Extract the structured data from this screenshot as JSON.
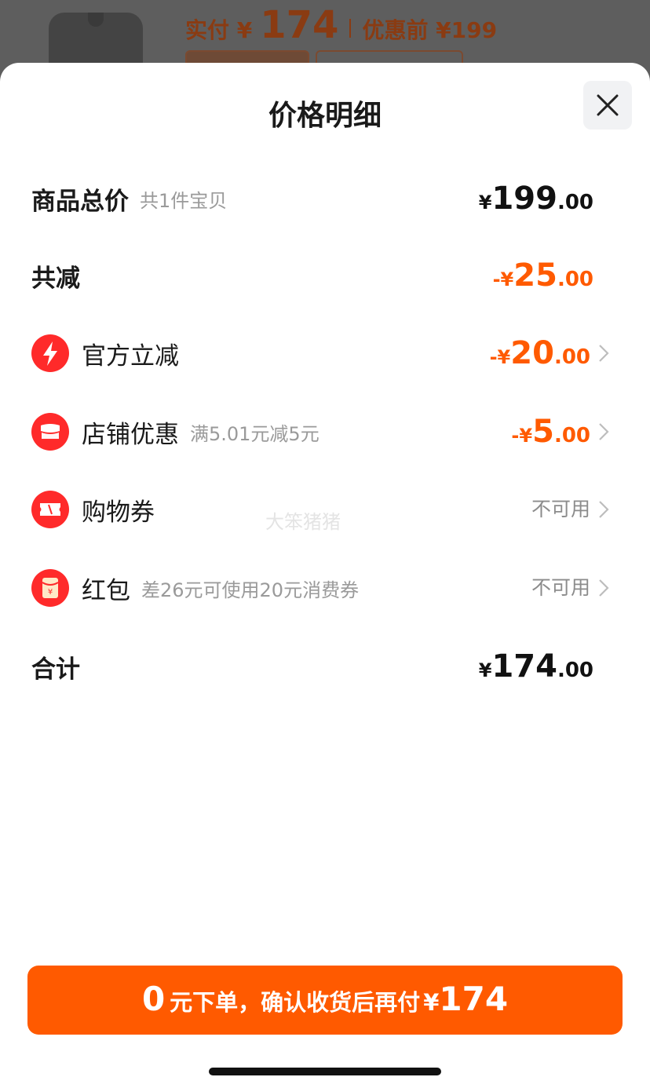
{
  "background": {
    "paid_label": "实付 ¥",
    "paid_amount": "174",
    "original_price": "优惠前 ¥199"
  },
  "sheet": {
    "title": "价格明细"
  },
  "rows": {
    "goods_total": {
      "label": "商品总价",
      "sub": "共1件宝贝",
      "yen": "¥",
      "int": "199",
      "dec": ".00"
    },
    "total_reduce": {
      "label": "共减",
      "prefix": "-¥",
      "int": "25",
      "dec": ".00"
    },
    "official": {
      "label": "官方立减",
      "prefix": "-¥",
      "int": "20",
      "dec": ".00",
      "icon": "lightning-icon"
    },
    "shop": {
      "label": "店铺优惠",
      "sub": "满5.01元减5元",
      "prefix": "-¥",
      "int": "5",
      "dec": ".00",
      "icon": "shop-icon"
    },
    "coupon": {
      "label": "购物券",
      "status": "不可用",
      "icon": "ticket-icon"
    },
    "red_packet": {
      "label": "红包",
      "sub": "差26元可使用20元消费券",
      "status": "不可用",
      "icon": "red-packet-icon"
    },
    "sum": {
      "label": "合计",
      "yen": "¥",
      "int": "174",
      "dec": ".00"
    }
  },
  "watermark": "大笨猪猪",
  "cta": {
    "zero": "0",
    "text": "元下单，确认收货后再付",
    "yen": "¥",
    "amount": "174"
  },
  "colors": {
    "accent": "#ff5a00",
    "icon_red": "#ff2a2a"
  }
}
